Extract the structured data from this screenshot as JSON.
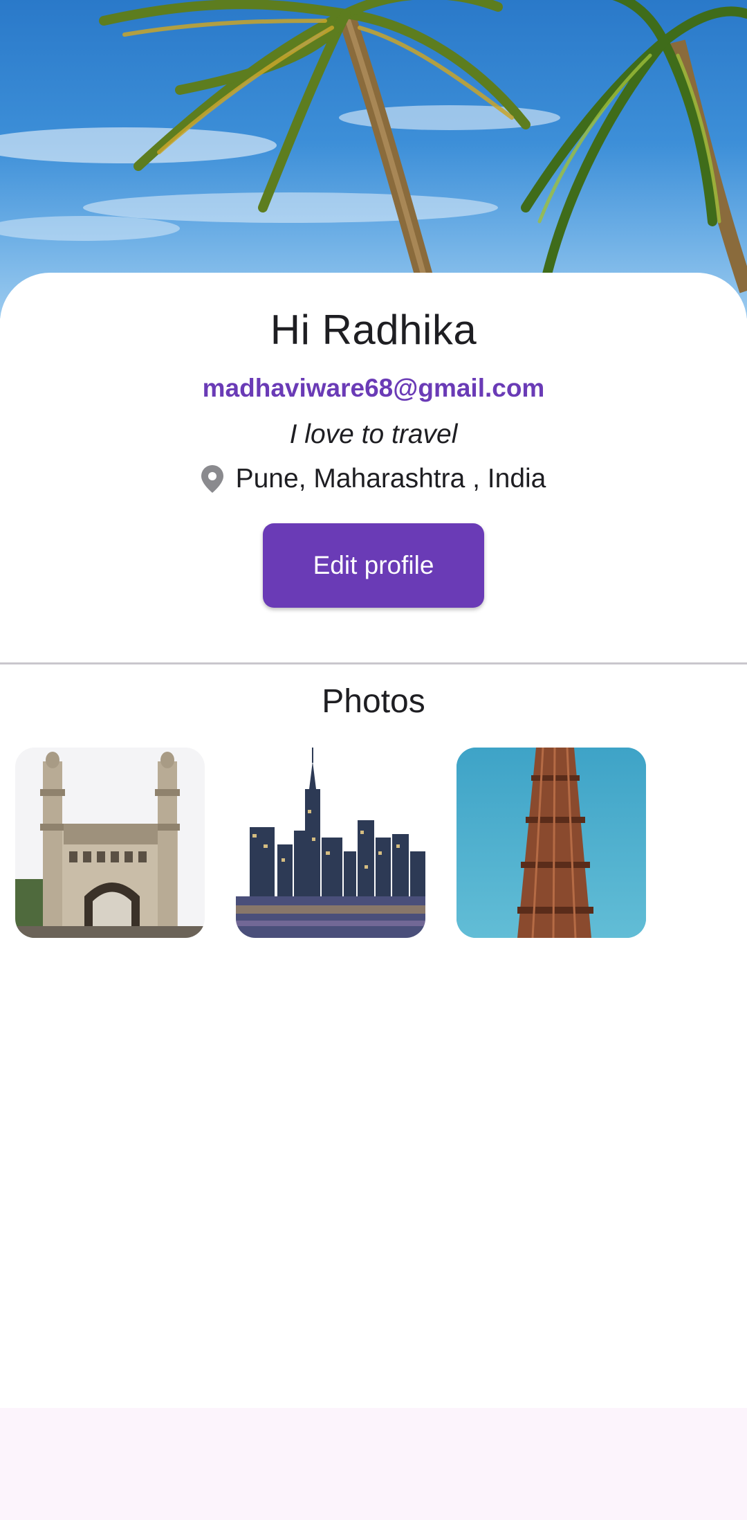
{
  "profile": {
    "greeting": "Hi Radhika",
    "email": "madhaviware68@gmail.com",
    "bio": "I love to travel",
    "location": "Pune, Maharashtra , India",
    "edit_label": "Edit profile"
  },
  "photos": {
    "title": "Photos",
    "items": [
      {
        "subject": "charminar"
      },
      {
        "subject": "city-skyline"
      },
      {
        "subject": "qutub-minar"
      }
    ]
  },
  "colors": {
    "accent": "#6a3bb6",
    "text": "#1e1e22",
    "divider": "#c9c7cd",
    "bottom_bar": "#fcf4fc"
  },
  "icons": {
    "location": "location-pin-icon"
  }
}
